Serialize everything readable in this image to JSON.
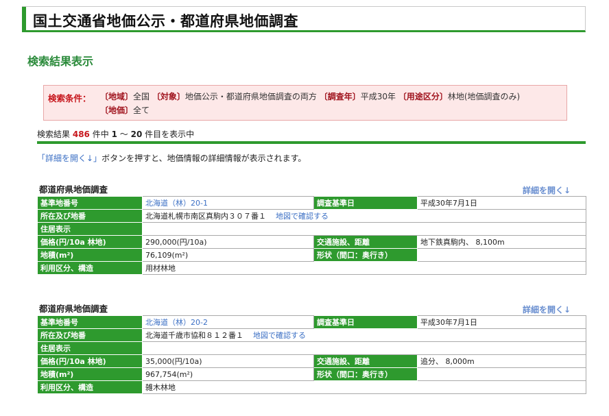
{
  "header": {
    "title": "国土交通省地価公示・都道府県地価調査"
  },
  "section_title": "検索結果表示",
  "conditions": {
    "label": "検索条件：",
    "region_key": "〔地域〕",
    "region_value": "全国",
    "target_key": "〔対象〕",
    "target_value": "地価公示・都道府県地価調査の両方",
    "year_key": "〔調査年〕",
    "year_value": "平成30年",
    "use_key": "〔用途区分〕",
    "use_value": "林地(地価調査のみ)",
    "price_key": "〔地価〕",
    "price_value": "全て"
  },
  "results": {
    "prefix": "検索結果",
    "total": "486",
    "mid": "件中",
    "from": "1",
    "tilde": "～",
    "to": "20",
    "suffix": "件目を表示中"
  },
  "help": {
    "link": "「詳細を開く↓」",
    "text": "ボタンを押すと、地価情報の詳細情報が表示されます。"
  },
  "labels": {
    "block_title": "都道府県地価調査",
    "detail_link": "詳細を開く↓",
    "standard_no": "基準地番号",
    "survey_date": "調査基準日",
    "location": "所在及び地番",
    "residence": "住居表示",
    "price": "価格(円/10a 林地)",
    "transport": "交通施設、距離",
    "area": "地積(m²)",
    "shape": "形状（間口：奥行き）",
    "land_use": "利用区分、構造",
    "map_link": "地図で確認する"
  },
  "entries": [
    {
      "standard_no": "北海道（林）20-1",
      "survey_date": "平成30年7月1日",
      "location": "北海道札幌市南区真駒内３０７番１",
      "residence": "",
      "price": "290,000(円/10a)",
      "transport": "地下鉄真駒内、 8,100m",
      "area": "76,109(m²)",
      "shape": "",
      "land_use": "用材林地"
    },
    {
      "standard_no": "北海道（林）20-2",
      "survey_date": "平成30年7月1日",
      "location": "北海道千歳市協和８１２番１",
      "residence": "",
      "price": "35,000(円/10a)",
      "transport": "追分、 8,000m",
      "area": "967,754(m²)",
      "shape": "",
      "land_use": "雑木林地"
    }
  ]
}
